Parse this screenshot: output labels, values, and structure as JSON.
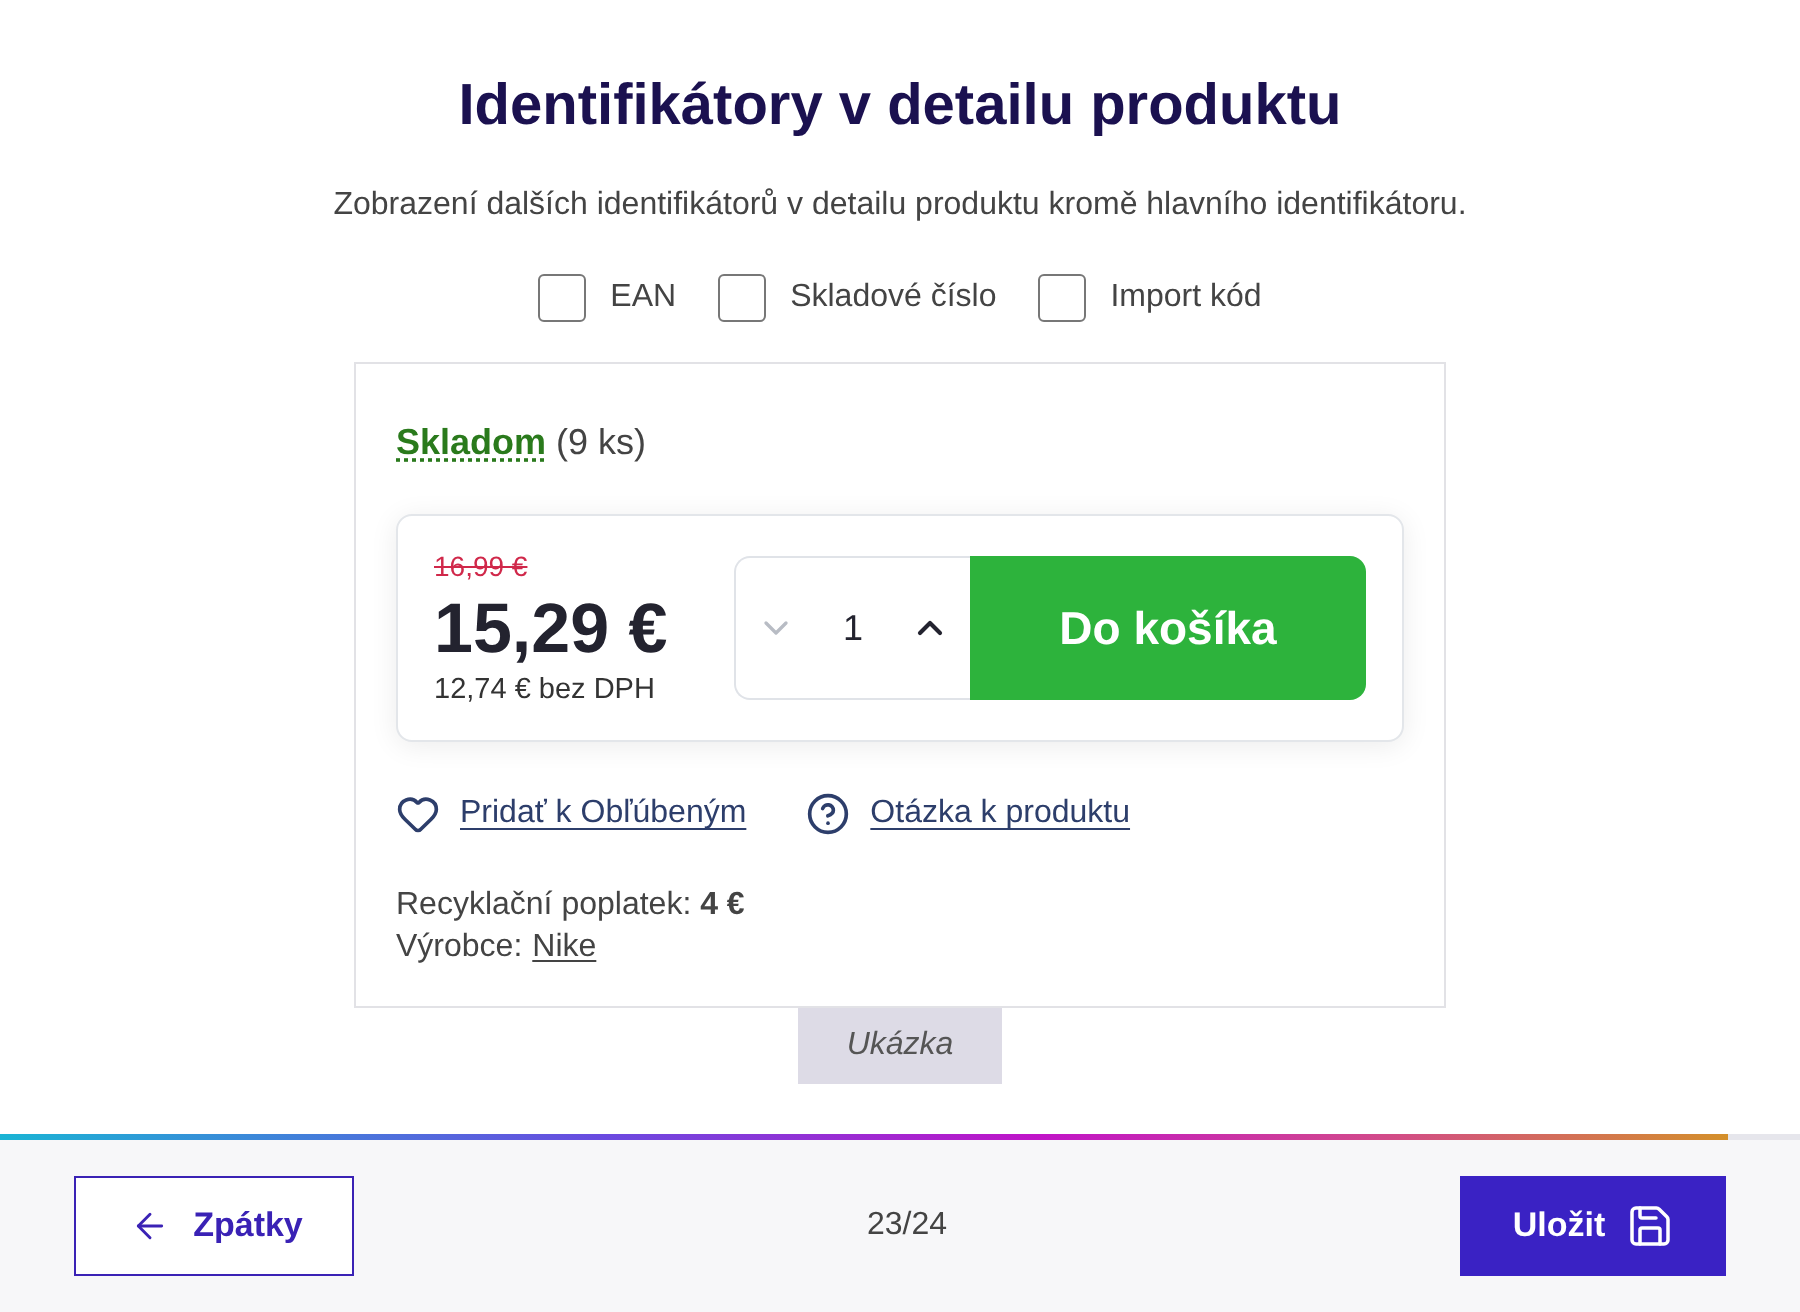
{
  "title": "Identifikátory v detailu produktu",
  "description": "Zobrazení dalších identifikátorů v detailu produktu kromě hlavního identifikátoru.",
  "options": [
    {
      "label": "EAN",
      "checked": false
    },
    {
      "label": "Skladové číslo",
      "checked": false
    },
    {
      "label": "Import kód",
      "checked": false
    }
  ],
  "preview": {
    "stock": {
      "status": "Skladom",
      "count": "(9 ks)"
    },
    "old_price": "16,99 €",
    "price": "15,29 €",
    "price_without_vat": "12,74 € bez DPH",
    "stepper": {
      "value": "1",
      "decrease_disabled": true
    },
    "add_to_cart": "Do košíka",
    "links": [
      {
        "kind": "favorite",
        "label": "Pridať k Obľúbeným"
      },
      {
        "kind": "question",
        "label": "Otázka k produktu"
      }
    ],
    "recycling_fee": "Recyklační poplatek: **4 €**",
    "manufacturer": {
      "label": "Výrobce:",
      "value": "Nike"
    },
    "caption": "Ukázka"
  },
  "progress": {
    "level": 0.96
  },
  "footer": {
    "back": "Zpátky",
    "step": "23/24",
    "save": "Uložit"
  }
}
